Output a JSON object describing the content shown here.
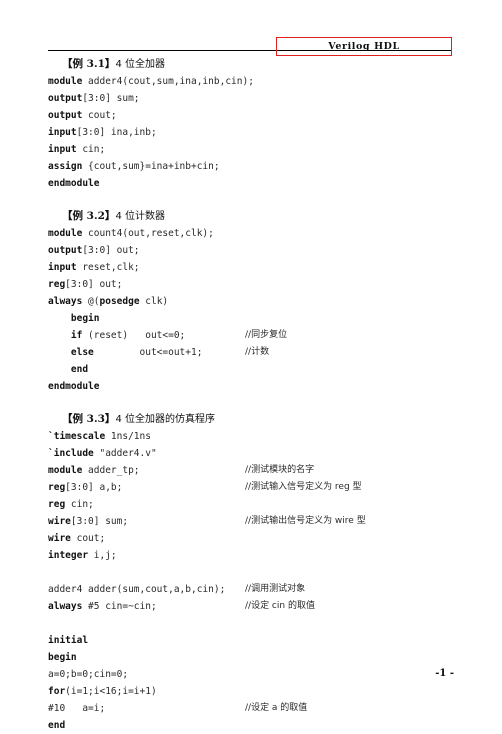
{
  "header": {
    "title": "Verilog  HDL",
    "box_color": "#e02020",
    "rule_color": "#000000"
  },
  "footer": {
    "page_label": "-1 -"
  },
  "examples": [
    {
      "id": "example-3-1",
      "number": "【例 3.1】",
      "caption": "4 位全加器",
      "lines": [
        {
          "kw": "module ",
          "rest": "adder4(cout,sum,ina,inb,cin);",
          "comment": ""
        },
        {
          "kw": "output",
          "rest": "[3:0] sum;",
          "comment": ""
        },
        {
          "kw": "output ",
          "rest": "cout;",
          "comment": ""
        },
        {
          "kw": "input",
          "rest": "[3:0] ina,inb;",
          "comment": ""
        },
        {
          "kw": "input ",
          "rest": "cin;",
          "comment": ""
        },
        {
          "kw": "assign ",
          "rest": "{cout,sum}=ina+inb+cin;",
          "comment": ""
        },
        {
          "kw": "endmodule",
          "rest": "",
          "comment": ""
        }
      ]
    },
    {
      "id": "example-3-2",
      "number": "【例 3.2】",
      "caption": "4 位计数器",
      "lines": [
        {
          "kw": "module ",
          "rest": "count4(out,reset,clk);",
          "comment": ""
        },
        {
          "kw": "output",
          "rest": "[3:0] out;",
          "comment": ""
        },
        {
          "kw": "input ",
          "rest": "reset,clk;",
          "comment": ""
        },
        {
          "kw": "reg",
          "rest": "[3:0] out;",
          "comment": ""
        },
        {
          "kw": "always ",
          "rest": "@(",
          "kw2": "posedge ",
          "rest2": "clk)",
          "comment": ""
        },
        {
          "kw": "    begin",
          "rest": "",
          "comment": ""
        },
        {
          "kw": "    if ",
          "rest": "(reset)   out<=0;",
          "comment": "//同步复位"
        },
        {
          "kw": "    else",
          "rest": "        out<=out+1;",
          "comment": "//计数"
        },
        {
          "kw": "    end",
          "rest": "",
          "comment": ""
        },
        {
          "kw": "endmodule",
          "rest": "",
          "comment": ""
        }
      ]
    },
    {
      "id": "example-3-3",
      "number": "【例 3.3】",
      "caption": "4 位全加器的仿真程序",
      "lines": [
        {
          "kw": "`timescale ",
          "rest": "1ns/1ns",
          "comment": ""
        },
        {
          "kw": "`include ",
          "rest": "\"adder4.v\"",
          "comment": ""
        },
        {
          "kw": "module ",
          "rest": "adder_tp;",
          "comment": "//测试模块的名字"
        },
        {
          "kw": "reg",
          "rest": "[3:0] a,b;",
          "comment": "//测试输入信号定义为 reg 型"
        },
        {
          "kw": "reg ",
          "rest": "cin;",
          "comment": ""
        },
        {
          "kw": "wire",
          "rest": "[3:0] sum;",
          "comment": "//测试输出信号定义为 wire 型"
        },
        {
          "kw": "wire ",
          "rest": "cout;",
          "comment": ""
        },
        {
          "kw": "integer ",
          "rest": "i,j;",
          "comment": ""
        },
        {
          "kw": "",
          "rest": "",
          "comment": ""
        },
        {
          "kw": "",
          "rest": "adder4 adder(sum,cout,a,b,cin);",
          "comment": "//调用测试对象"
        },
        {
          "kw": "always ",
          "rest": "#5 cin=~cin;",
          "comment": "//设定 cin 的取值"
        },
        {
          "kw": "",
          "rest": "",
          "comment": ""
        },
        {
          "kw": "initial",
          "rest": "",
          "comment": ""
        },
        {
          "kw": "begin",
          "rest": "",
          "comment": ""
        },
        {
          "kw": "",
          "rest": "a=0;b=0;cin=0;",
          "comment": ""
        },
        {
          "kw": "for",
          "rest": "(i=1;i<16;i=i+1)",
          "comment": ""
        },
        {
          "kw": "",
          "rest": "#10   a=i;",
          "comment": "//设定 a 的取值"
        },
        {
          "kw": "end",
          "rest": "",
          "comment": ""
        }
      ]
    }
  ]
}
